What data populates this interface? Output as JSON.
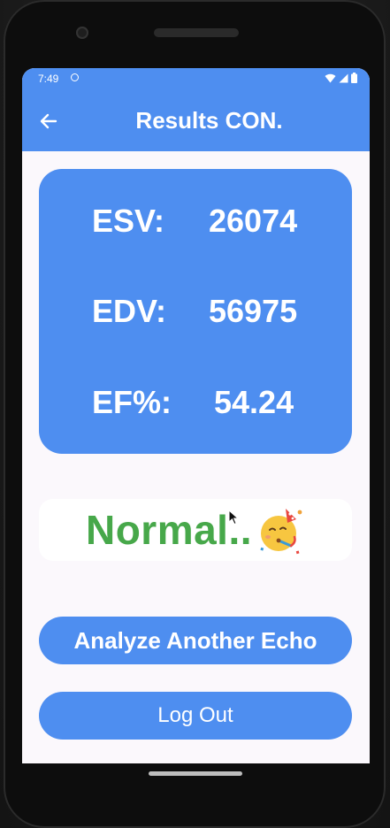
{
  "status_bar": {
    "time": "7:49"
  },
  "app_bar": {
    "title": "Results CON."
  },
  "results": [
    {
      "label": "ESV:",
      "value": "26074"
    },
    {
      "label": "EDV:",
      "value": "56975"
    },
    {
      "label": "EF%:",
      "value": "54.24"
    }
  ],
  "assessment": {
    "text": "Normal..",
    "icon": "party-face-icon"
  },
  "buttons": {
    "analyze": "Analyze Another Echo",
    "logout": "Log Out"
  },
  "colors": {
    "primary": "#4e8ef0",
    "normal_text": "#47a84a",
    "background": "#fbf8fc"
  }
}
